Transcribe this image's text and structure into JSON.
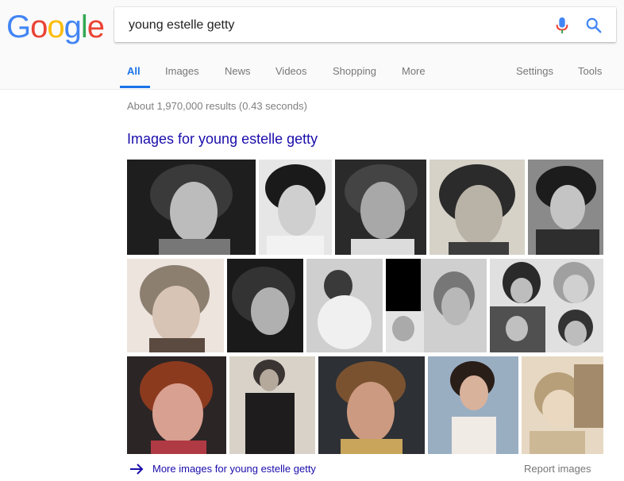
{
  "logo": {
    "letters": [
      "G",
      "o",
      "o",
      "g",
      "l",
      "e"
    ],
    "colors": [
      "#4285F4",
      "#EA4335",
      "#FBBC05",
      "#4285F4",
      "#34A853",
      "#EA4335"
    ]
  },
  "search": {
    "query": "young estelle getty",
    "mic_icon": "microphone-icon",
    "search_icon": "search-icon"
  },
  "tabs": {
    "all": "All",
    "images": "Images",
    "news": "News",
    "videos": "Videos",
    "shopping": "Shopping",
    "more": "More",
    "settings": "Settings",
    "tools": "Tools"
  },
  "results": {
    "stats": "About 1,970,000 results (0.43 seconds)"
  },
  "image_pack": {
    "heading": "Images for young estelle getty",
    "more_link": "More images for young estelle getty",
    "report": "Report images",
    "accent": "#1a0dab"
  }
}
